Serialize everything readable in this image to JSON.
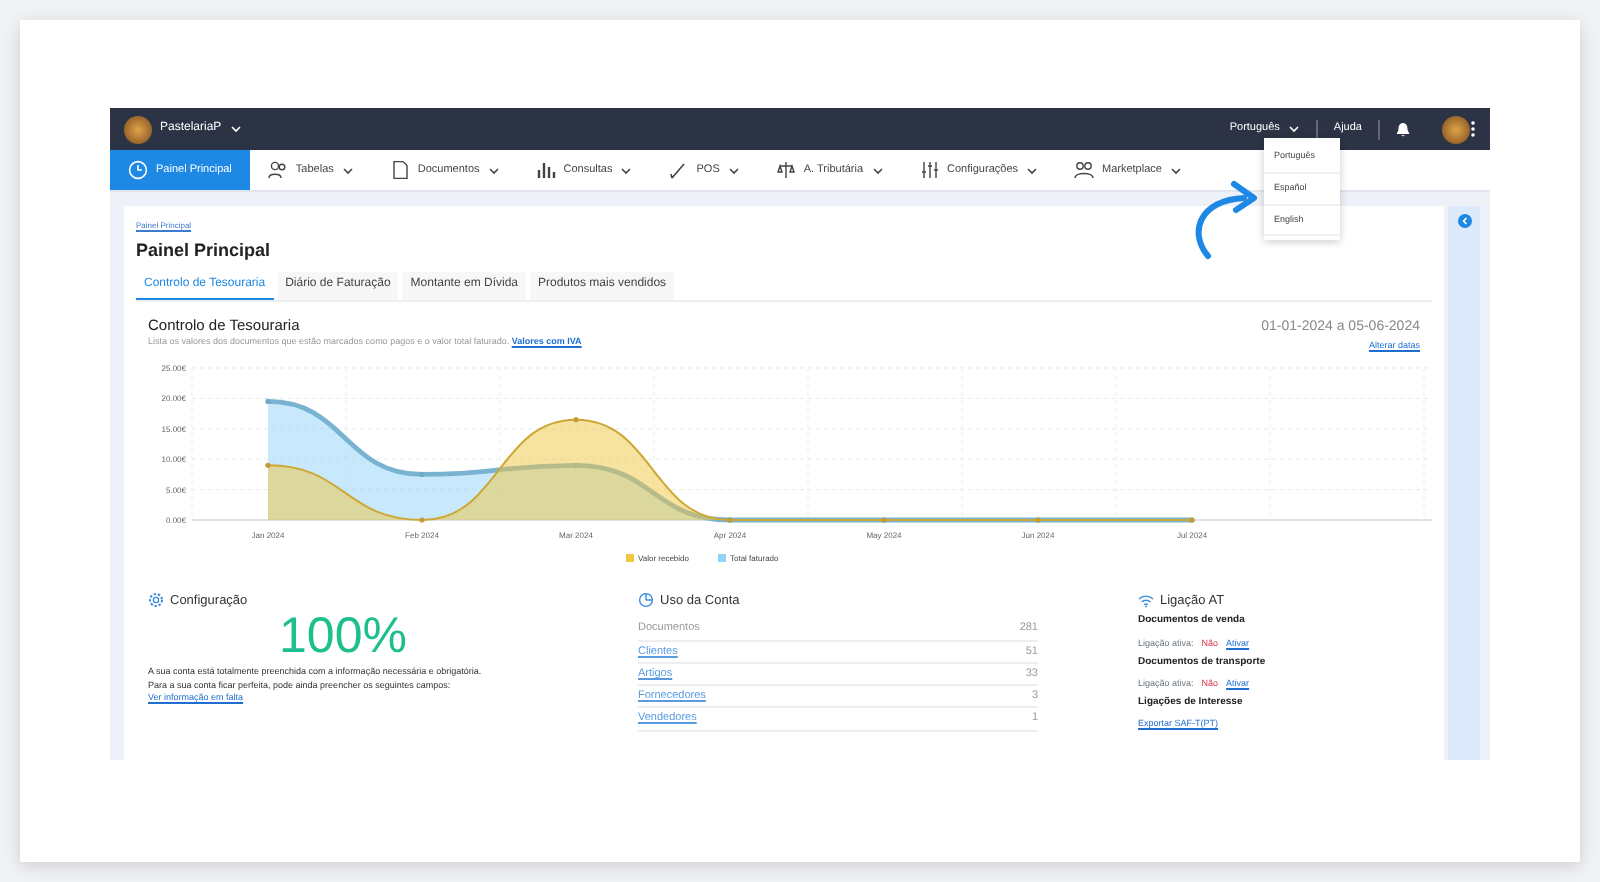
{
  "navbar": {
    "company": "PastelariaP",
    "language": "Português",
    "help": "Ajuda"
  },
  "language_menu": {
    "items": [
      "Português",
      "Español",
      "English"
    ]
  },
  "menu": [
    {
      "label": "Painel Principal",
      "selected": true,
      "dropdown": false
    },
    {
      "label": "Tabelas",
      "selected": false,
      "dropdown": true
    },
    {
      "label": "Documentos",
      "selected": false,
      "dropdown": true
    },
    {
      "label": "Consultas",
      "selected": false,
      "dropdown": true
    },
    {
      "label": "POS",
      "selected": false,
      "dropdown": true
    },
    {
      "label": "A. Tributária",
      "selected": false,
      "dropdown": true
    },
    {
      "label": "Configurações",
      "selected": false,
      "dropdown": true
    },
    {
      "label": "Marketplace",
      "selected": false,
      "dropdown": true
    }
  ],
  "breadcrumb": "Painel Principal",
  "title": "Painel Principal",
  "tabs": [
    {
      "label": "Controlo de Tesouraria",
      "selected": true
    },
    {
      "label": "Diário de Faturação",
      "selected": false
    },
    {
      "label": "Montante em Dívida",
      "selected": false
    },
    {
      "label": "Produtos mais vendidos",
      "selected": false
    }
  ],
  "treasury": {
    "title": "Controlo de Tesouraria",
    "description": "Lista os valores dos documentos que estão marcados como pagos e o valor total faturado.",
    "vat_link": "Valores com IVA",
    "date_range": "01-01-2024 a 05-06-2024",
    "change_dates": "Alterar datas",
    "chart_data": {
      "type": "area",
      "categories": [
        "Jan 2024",
        "Feb 2024",
        "Mar 2024",
        "Apr 2024",
        "May 2024",
        "Jun 2024",
        "Jul 2024"
      ],
      "series": [
        {
          "name": "Valor recebido",
          "color": "#f2c63f",
          "values": [
            9,
            0,
            16.5,
            0,
            0,
            0,
            0
          ]
        },
        {
          "name": "Total faturado",
          "color": "#8fd3f7",
          "values": [
            19.5,
            7.5,
            9,
            0,
            0,
            0,
            0
          ]
        }
      ],
      "ylim": [
        0,
        25
      ],
      "grid": true,
      "legend": "bottom",
      "yticks": [
        {
          "value": 0,
          "label": "0.00€"
        },
        {
          "value": 5,
          "label": "5.00€"
        },
        {
          "value": 10,
          "label": "10.00€"
        },
        {
          "value": 15,
          "label": "15.00€"
        },
        {
          "value": 20,
          "label": "20.00€"
        },
        {
          "value": 25,
          "label": "25.00€"
        }
      ]
    }
  },
  "configuration": {
    "title": "Configuração",
    "percent": "100%",
    "text": "A sua conta está totalmente preenchida com a informação necessária e obrigatória.",
    "text2": "Para a sua conta ficar perfeita, pode ainda preencher os seguintes campos:",
    "link": "Ver informação em falta"
  },
  "account_usage": {
    "title": "Uso da Conta",
    "rows": [
      {
        "label": "Documentos",
        "count": "281",
        "kind": "text"
      },
      {
        "label": "Clientes",
        "count": "51",
        "kind": "link"
      },
      {
        "label": "Artigos",
        "count": "33",
        "kind": "link"
      },
      {
        "label": "Fornecedores",
        "count": "3",
        "kind": "link"
      },
      {
        "label": "Vendedores",
        "count": "1",
        "kind": "link"
      }
    ]
  },
  "at_connection": {
    "title": "Ligação AT",
    "groups": [
      {
        "title": "Documentos de venda",
        "status_label": "Ligação ativa:",
        "status": "Não",
        "action": "Ativar"
      },
      {
        "title": "Documentos de transporte",
        "status_label": "Ligação ativa:",
        "status": "Não",
        "action": "Ativar"
      }
    ],
    "interest_title": "Ligações de Interesse",
    "interest_link": "Exportar SAF-T(PT)"
  }
}
